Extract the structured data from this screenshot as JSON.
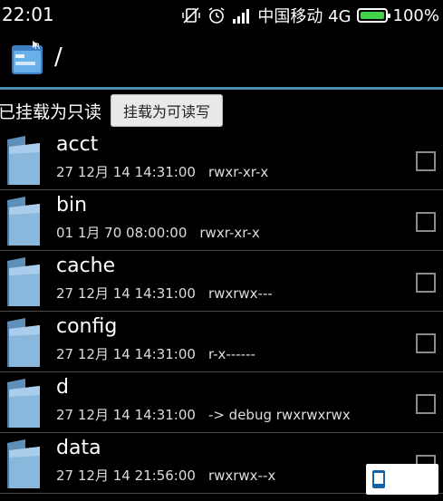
{
  "status_bar": {
    "time": "22:01",
    "carrier": "中国移动 4G",
    "battery_percent": "100%",
    "battery_level": 1.0,
    "icons": [
      "vibrate-off-icon",
      "alarm-icon",
      "signal-icon",
      "battery-icon"
    ]
  },
  "title_bar": {
    "path": "/",
    "app_icon": "root-explorer-icon"
  },
  "mount": {
    "status_text": "已挂载为只读",
    "button_label": "挂载为可读写"
  },
  "files": [
    {
      "name": "acct",
      "date": "27 12月 14 14:31:00",
      "perm": "rwxr-xr-x"
    },
    {
      "name": "bin",
      "date": "01 1月 70 08:00:00",
      "perm": "rwxr-xr-x"
    },
    {
      "name": "cache",
      "date": "27 12月 14 14:31:00",
      "perm": "rwxrwx---"
    },
    {
      "name": "config",
      "date": "27 12月 14 14:31:00",
      "perm": "r-x------"
    },
    {
      "name": "d",
      "date": "27 12月 14 14:31:00",
      "perm": "-> debug  rwxrwxrwx"
    },
    {
      "name": "data",
      "date": "27 12月 14 21:56:00",
      "perm": "rwxrwx--x"
    }
  ],
  "colors": {
    "accent_line": "#4a8fb0",
    "folder_blue": "#8ab8dc",
    "battery_green": "#3fd24a"
  }
}
